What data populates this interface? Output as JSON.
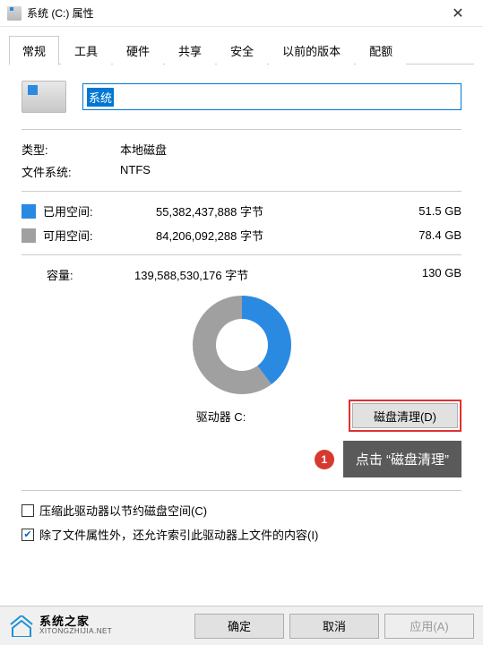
{
  "window": {
    "title": "系统 (C:) 属性"
  },
  "tabs": {
    "general": "常规",
    "tools": "工具",
    "hardware": "硬件",
    "sharing": "共享",
    "security": "安全",
    "previous": "以前的版本",
    "quota": "配额"
  },
  "name_field": {
    "value": "系统"
  },
  "type": {
    "label": "类型:",
    "value": "本地磁盘"
  },
  "fs": {
    "label": "文件系统:",
    "value": "NTFS"
  },
  "used": {
    "label": "已用空间:",
    "bytes": "55,382,437,888 字节",
    "human": "51.5 GB"
  },
  "free": {
    "label": "可用空间:",
    "bytes": "84,206,092,288 字节",
    "human": "78.4 GB"
  },
  "capacity": {
    "label": "容量:",
    "bytes": "139,588,530,176 字节",
    "human": "130 GB"
  },
  "driver_label": "驱动器 C:",
  "cleanup_button": "磁盘清理(D)",
  "callout": {
    "num": "1",
    "text": "点击 “磁盘清理”"
  },
  "compress": {
    "checked": false,
    "label": "压缩此驱动器以节约磁盘空间(C)"
  },
  "index": {
    "checked": true,
    "label": "除了文件属性外，还允许索引此驱动器上文件的内容(I)"
  },
  "buttons": {
    "ok": "确定",
    "cancel": "取消",
    "apply": "应用(A)"
  },
  "brand": {
    "name": "系统之家",
    "url": "XITONGZHIJIA.NET"
  },
  "chart_data": {
    "type": "pie",
    "title": "驱动器 C:",
    "series": [
      {
        "name": "已用空间",
        "value": 55382437888,
        "human": "51.5 GB",
        "color": "#2a8ae2"
      },
      {
        "name": "可用空间",
        "value": 84206092288,
        "human": "78.4 GB",
        "color": "#a0a0a0"
      }
    ],
    "total": {
      "value": 139588530176,
      "human": "130 GB"
    }
  }
}
